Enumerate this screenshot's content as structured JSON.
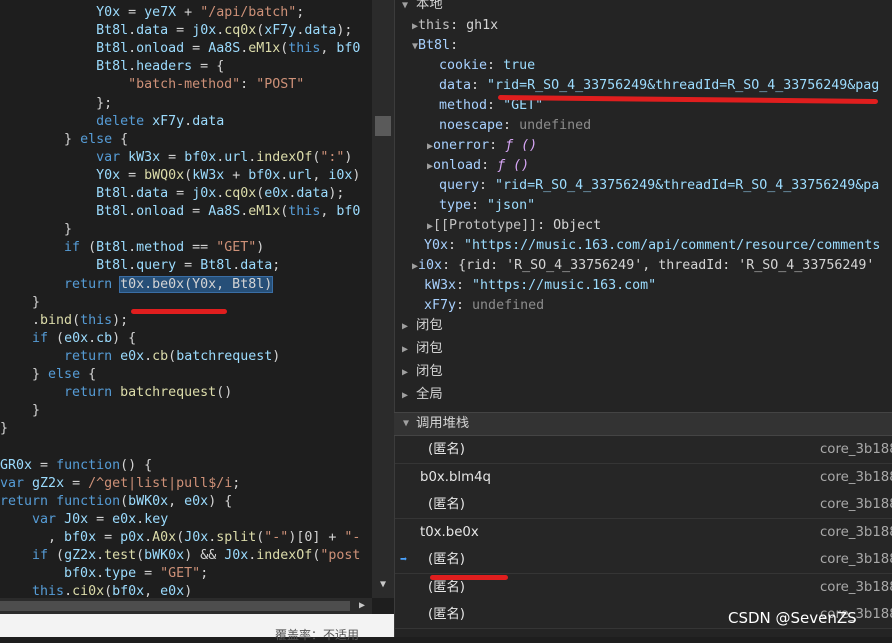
{
  "code_lines": [
    {
      "parts": [
        [
          "d",
          "            "
        ],
        [
          "p",
          "Y0x"
        ],
        [
          "d",
          " = "
        ],
        [
          "p",
          "ye7X"
        ],
        [
          "d",
          " + "
        ],
        [
          "s",
          "\"/api/batch\""
        ],
        [
          "d",
          ";"
        ]
      ]
    },
    {
      "parts": [
        [
          "d",
          "            "
        ],
        [
          "p",
          "Bt8l"
        ],
        [
          "d",
          "."
        ],
        [
          "p",
          "data"
        ],
        [
          "d",
          " = "
        ],
        [
          "p",
          "j0x"
        ],
        [
          "d",
          "."
        ],
        [
          "f",
          "cq0x"
        ],
        [
          "d",
          "("
        ],
        [
          "p",
          "xF7y"
        ],
        [
          "d",
          "."
        ],
        [
          "p",
          "data"
        ],
        [
          "d",
          ");"
        ]
      ]
    },
    {
      "parts": [
        [
          "d",
          "            "
        ],
        [
          "p",
          "Bt8l"
        ],
        [
          "d",
          "."
        ],
        [
          "p",
          "onload"
        ],
        [
          "d",
          " = "
        ],
        [
          "p",
          "Aa8S"
        ],
        [
          "d",
          "."
        ],
        [
          "f",
          "eM1x"
        ],
        [
          "d",
          "("
        ],
        [
          "k",
          "this"
        ],
        [
          "d",
          ", "
        ],
        [
          "p",
          "bf0"
        ]
      ]
    },
    {
      "parts": [
        [
          "d",
          "            "
        ],
        [
          "p",
          "Bt8l"
        ],
        [
          "d",
          "."
        ],
        [
          "p",
          "headers"
        ],
        [
          "d",
          " = {"
        ]
      ]
    },
    {
      "parts": [
        [
          "d",
          "                "
        ],
        [
          "s",
          "\"batch-method\""
        ],
        [
          "d",
          ": "
        ],
        [
          "s",
          "\"POST\""
        ]
      ]
    },
    {
      "parts": [
        [
          "d",
          "            };"
        ]
      ]
    },
    {
      "parts": [
        [
          "d",
          "            "
        ],
        [
          "k",
          "delete"
        ],
        [
          "d",
          " "
        ],
        [
          "p",
          "xF7y"
        ],
        [
          "d",
          "."
        ],
        [
          "p",
          "data"
        ]
      ]
    },
    {
      "parts": [
        [
          "d",
          "        } "
        ],
        [
          "k",
          "else"
        ],
        [
          "d",
          " {"
        ]
      ]
    },
    {
      "parts": [
        [
          "d",
          "            "
        ],
        [
          "k",
          "var"
        ],
        [
          "d",
          " "
        ],
        [
          "p",
          "kW3x"
        ],
        [
          "d",
          " = "
        ],
        [
          "p",
          "bf0x"
        ],
        [
          "d",
          "."
        ],
        [
          "p",
          "url"
        ],
        [
          "d",
          "."
        ],
        [
          "f",
          "indexOf"
        ],
        [
          "d",
          "("
        ],
        [
          "s",
          "\":\""
        ],
        [
          "d",
          ")"
        ]
      ]
    },
    {
      "parts": [
        [
          "d",
          "            "
        ],
        [
          "p",
          "Y0x"
        ],
        [
          "d",
          " = "
        ],
        [
          "f",
          "bWQ0x"
        ],
        [
          "d",
          "("
        ],
        [
          "p",
          "kW3x"
        ],
        [
          "d",
          " + "
        ],
        [
          "p",
          "bf0x"
        ],
        [
          "d",
          "."
        ],
        [
          "p",
          "url"
        ],
        [
          "d",
          ", "
        ],
        [
          "p",
          "i0x"
        ],
        [
          "d",
          ")"
        ]
      ]
    },
    {
      "parts": [
        [
          "d",
          "            "
        ],
        [
          "p",
          "Bt8l"
        ],
        [
          "d",
          "."
        ],
        [
          "p",
          "data"
        ],
        [
          "d",
          " = "
        ],
        [
          "p",
          "j0x"
        ],
        [
          "d",
          "."
        ],
        [
          "f",
          "cq0x"
        ],
        [
          "d",
          "("
        ],
        [
          "p",
          "e0x"
        ],
        [
          "d",
          "."
        ],
        [
          "p",
          "data"
        ],
        [
          "d",
          ");"
        ]
      ]
    },
    {
      "parts": [
        [
          "d",
          "            "
        ],
        [
          "p",
          "Bt8l"
        ],
        [
          "d",
          "."
        ],
        [
          "p",
          "onload"
        ],
        [
          "d",
          " = "
        ],
        [
          "p",
          "Aa8S"
        ],
        [
          "d",
          "."
        ],
        [
          "f",
          "eM1x"
        ],
        [
          "d",
          "("
        ],
        [
          "k",
          "this"
        ],
        [
          "d",
          ", "
        ],
        [
          "p",
          "bf0"
        ]
      ]
    },
    {
      "parts": [
        [
          "d",
          "        }"
        ]
      ]
    },
    {
      "parts": [
        [
          "d",
          "        "
        ],
        [
          "k",
          "if"
        ],
        [
          "d",
          " ("
        ],
        [
          "p",
          "Bt8l"
        ],
        [
          "d",
          "."
        ],
        [
          "p",
          "method"
        ],
        [
          "d",
          " == "
        ],
        [
          "s",
          "\"GET\""
        ],
        [
          "d",
          ")"
        ]
      ]
    },
    {
      "parts": [
        [
          "d",
          "            "
        ],
        [
          "p",
          "Bt8l"
        ],
        [
          "d",
          "."
        ],
        [
          "p",
          "query"
        ],
        [
          "d",
          " = "
        ],
        [
          "p",
          "Bt8l"
        ],
        [
          "d",
          "."
        ],
        [
          "p",
          "data"
        ],
        [
          "d",
          ";"
        ]
      ]
    },
    {
      "parts": [
        [
          "d",
          "        "
        ],
        [
          "k",
          "return"
        ],
        [
          "d",
          " "
        ],
        [
          "hl",
          "t0x.be0x(Y0x, Bt8l)"
        ]
      ]
    },
    {
      "parts": [
        [
          "d",
          "    }"
        ]
      ]
    },
    {
      "parts": [
        [
          "d",
          "    ."
        ],
        [
          "f",
          "bind"
        ],
        [
          "d",
          "("
        ],
        [
          "k",
          "this"
        ],
        [
          "d",
          ");"
        ]
      ]
    },
    {
      "parts": [
        [
          "d",
          "    "
        ],
        [
          "k",
          "if"
        ],
        [
          "d",
          " ("
        ],
        [
          "p",
          "e0x"
        ],
        [
          "d",
          "."
        ],
        [
          "p",
          "cb"
        ],
        [
          "d",
          ") {"
        ]
      ]
    },
    {
      "parts": [
        [
          "d",
          "        "
        ],
        [
          "k",
          "return"
        ],
        [
          "d",
          " "
        ],
        [
          "p",
          "e0x"
        ],
        [
          "d",
          "."
        ],
        [
          "f",
          "cb"
        ],
        [
          "d",
          "("
        ],
        [
          "p",
          "batchrequest"
        ],
        [
          "d",
          ")"
        ]
      ]
    },
    {
      "parts": [
        [
          "d",
          "    } "
        ],
        [
          "k",
          "else"
        ],
        [
          "d",
          " {"
        ]
      ]
    },
    {
      "parts": [
        [
          "d",
          "        "
        ],
        [
          "k",
          "return"
        ],
        [
          "d",
          " "
        ],
        [
          "f",
          "batchrequest"
        ],
        [
          "d",
          "()"
        ]
      ]
    },
    {
      "parts": [
        [
          "d",
          "    }"
        ]
      ]
    },
    {
      "parts": [
        [
          "d",
          "}"
        ]
      ]
    },
    {
      "parts": [
        [
          "d",
          ""
        ]
      ]
    },
    {
      "parts": [
        [
          "p",
          "GR0x"
        ],
        [
          "d",
          " = "
        ],
        [
          "k",
          "function"
        ],
        [
          "d",
          "() {"
        ]
      ]
    },
    {
      "parts": [
        [
          "k",
          "var"
        ],
        [
          "d",
          " "
        ],
        [
          "p",
          "gZ2x"
        ],
        [
          "d",
          " = "
        ],
        [
          "s",
          "/^get|list|pull$/i"
        ],
        [
          "d",
          ";"
        ]
      ]
    },
    {
      "parts": [
        [
          "k",
          "return"
        ],
        [
          "d",
          " "
        ],
        [
          "k",
          "function"
        ],
        [
          "d",
          "("
        ],
        [
          "p",
          "bWK0x"
        ],
        [
          "d",
          ", "
        ],
        [
          "p",
          "e0x"
        ],
        [
          "d",
          ") {"
        ]
      ]
    },
    {
      "parts": [
        [
          "d",
          "    "
        ],
        [
          "k",
          "var"
        ],
        [
          "d",
          " "
        ],
        [
          "p",
          "J0x"
        ],
        [
          "d",
          " = "
        ],
        [
          "p",
          "e0x"
        ],
        [
          "d",
          "."
        ],
        [
          "p",
          "key"
        ]
      ]
    },
    {
      "parts": [
        [
          "d",
          "      , "
        ],
        [
          "p",
          "bf0x"
        ],
        [
          "d",
          " = "
        ],
        [
          "p",
          "p0x"
        ],
        [
          "d",
          "."
        ],
        [
          "f",
          "A0x"
        ],
        [
          "d",
          "("
        ],
        [
          "p",
          "J0x"
        ],
        [
          "d",
          "."
        ],
        [
          "f",
          "split"
        ],
        [
          "d",
          "("
        ],
        [
          "s",
          "\"-\""
        ],
        [
          "d",
          ")[0] + "
        ],
        [
          "s",
          "\"-"
        ]
      ]
    },
    {
      "parts": [
        [
          "d",
          "    "
        ],
        [
          "k",
          "if"
        ],
        [
          "d",
          " ("
        ],
        [
          "p",
          "gZ2x"
        ],
        [
          "d",
          "."
        ],
        [
          "f",
          "test"
        ],
        [
          "d",
          "("
        ],
        [
          "p",
          "bWK0x"
        ],
        [
          "d",
          ") && "
        ],
        [
          "p",
          "J0x"
        ],
        [
          "d",
          "."
        ],
        [
          "f",
          "indexOf"
        ],
        [
          "d",
          "("
        ],
        [
          "s",
          "\"post"
        ]
      ]
    },
    {
      "parts": [
        [
          "d",
          "        "
        ],
        [
          "p",
          "bf0x"
        ],
        [
          "d",
          "."
        ],
        [
          "p",
          "type"
        ],
        [
          "d",
          " = "
        ],
        [
          "s",
          "\"GET\""
        ],
        [
          "d",
          ";"
        ]
      ]
    },
    {
      "parts": [
        [
          "d",
          "    "
        ],
        [
          "k",
          "this"
        ],
        [
          "d",
          "."
        ],
        [
          "f",
          "ci0x"
        ],
        [
          "d",
          "("
        ],
        [
          "p",
          "bf0x"
        ],
        [
          "d",
          ", "
        ],
        [
          "p",
          "e0x"
        ],
        [
          "d",
          ")"
        ]
      ]
    }
  ],
  "status": {
    "coverage": "覆盖率：不适用"
  },
  "scope": {
    "local_label": "本地",
    "this_key": "this",
    "this_val": "gh1x",
    "bt8l_key": "Bt8l",
    "props": [
      {
        "key": "cookie",
        "val": "true",
        "kind": "bool"
      },
      {
        "key": "data",
        "val": "\"rid=R_SO_4_33756249&threadId=R_SO_4_33756249&pag",
        "kind": "str"
      },
      {
        "key": "method",
        "val": "\"GET\"",
        "kind": "str"
      },
      {
        "key": "noescape",
        "val": "undefined",
        "kind": "undef"
      },
      {
        "key": "onerror",
        "val": "ƒ ()",
        "kind": "func"
      },
      {
        "key": "onload",
        "val": "ƒ ()",
        "kind": "func"
      },
      {
        "key": "query",
        "val": "\"rid=R_SO_4_33756249&threadId=R_SO_4_33756249&pa",
        "kind": "str"
      },
      {
        "key": "type",
        "val": "\"json\"",
        "kind": "str"
      },
      {
        "key": "[[Prototype]]",
        "val": "Object",
        "kind": "obj"
      }
    ],
    "y0x_key": "Y0x",
    "y0x_val": "\"https://music.163.com/api/comment/resource/comments",
    "i0x_key": "i0x",
    "i0x_val": "{rid: 'R_SO_4_33756249', threadId: 'R_SO_4_33756249'",
    "kw3x_key": "kW3x",
    "kw3x_val": "\"https://music.163.com\"",
    "xf7y_key": "xF7y",
    "xf7y_val": "undefined",
    "closures": [
      "闭包",
      "闭包",
      "闭包"
    ],
    "global_label": "全局"
  },
  "callstack": {
    "header": "调用堆栈",
    "frames": [
      {
        "name": "(匿名)",
        "loc": "core_3b188"
      },
      {
        "name": "b0x.blm4q",
        "loc": "core_3b188"
      },
      {
        "name": "(匿名)",
        "loc": "core_3b188"
      },
      {
        "name": "t0x.be0x",
        "loc": "core_3b188"
      },
      {
        "name": "(匿名)",
        "loc": "core_3b188"
      },
      {
        "name": "(匿名)",
        "loc": "core_3b188"
      },
      {
        "name": "(匿名)",
        "loc": "core_3b188"
      }
    ]
  },
  "watermark": "CSDN @SevenZS",
  "colors": {
    "annotation": "#e01e1e",
    "selection": "#264f78"
  }
}
